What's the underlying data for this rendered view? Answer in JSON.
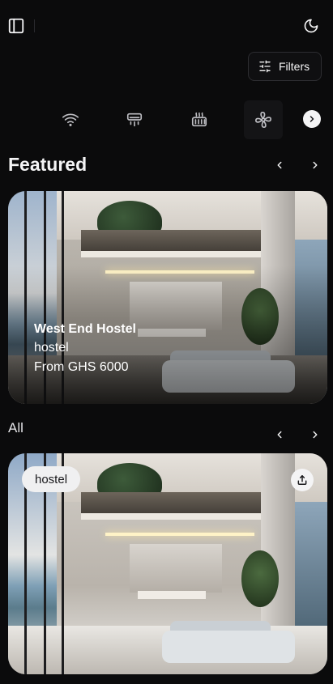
{
  "header": {
    "icons": {
      "sidebar": "sidebar-toggle-icon",
      "theme": "moon-icon"
    }
  },
  "filters": {
    "label": "Filters",
    "icon": "sliders-icon"
  },
  "amenities": {
    "items": [
      "wifi-icon",
      "air-conditioner-icon",
      "heater-icon",
      "fan-icon"
    ],
    "active_index": 3,
    "next_icon": "chevron-right-icon"
  },
  "featured": {
    "title": "Featured",
    "card": {
      "name": "West End Hostel",
      "type": "hostel",
      "price": "From GHS 6000"
    }
  },
  "all": {
    "title": "All",
    "card": {
      "type_badge": "hostel",
      "share_icon": "share-icon"
    }
  },
  "colors": {
    "background": "#0b0b0c",
    "foreground": "#f4f4f5",
    "border": "#2d2d31"
  }
}
